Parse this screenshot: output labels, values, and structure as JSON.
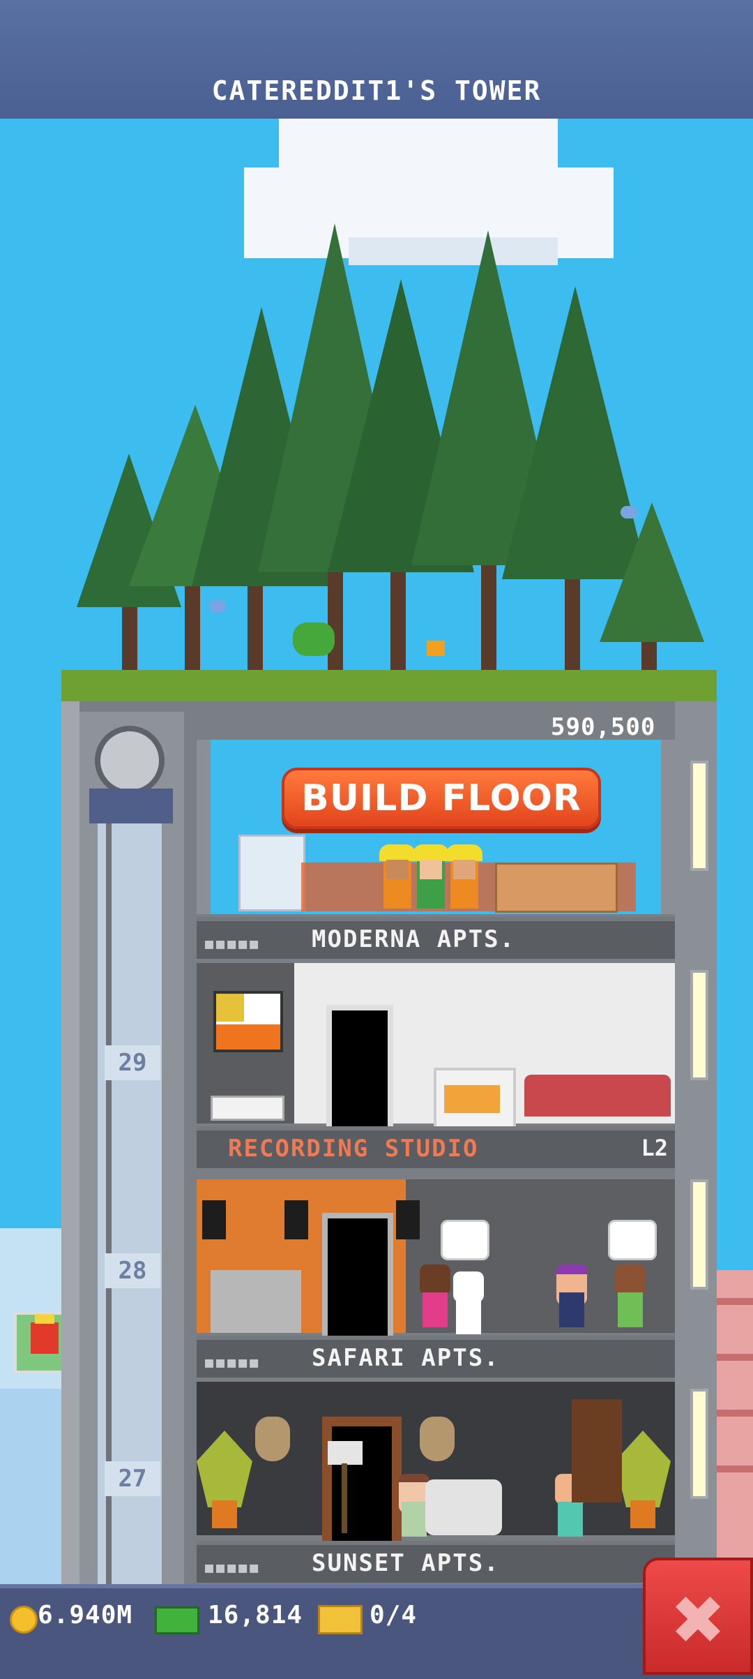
{
  "header": {
    "title": "CATEREDDIT1'S TOWER"
  },
  "construction": {
    "price": "590,500",
    "build_button_label": "BUILD FLOOR"
  },
  "floors": [
    {
      "name": "MODERNA APTS.",
      "residents_icon": "resident-dots"
    },
    {
      "name": "RECORDING STUDIO",
      "level": "L2"
    },
    {
      "name": "SAFARI APTS.",
      "residents_icon": "resident-dots"
    },
    {
      "name": "SUNSET APTS.",
      "residents_icon": "resident-dots"
    }
  ],
  "elevator": {
    "floor_numbers": [
      "29",
      "28",
      "27"
    ]
  },
  "status_bar": {
    "coins": "6.940M",
    "bux": "16,814",
    "tickets": "0/4"
  },
  "colors": {
    "sky": "#3dbcf0",
    "header": "#5a71a3",
    "build_button": "#ef5a28",
    "close_button": "#d93434"
  },
  "icons": [
    "coin-icon",
    "bux-icon",
    "ticket-icon",
    "close-icon",
    "elevator-pulley-icon"
  ]
}
